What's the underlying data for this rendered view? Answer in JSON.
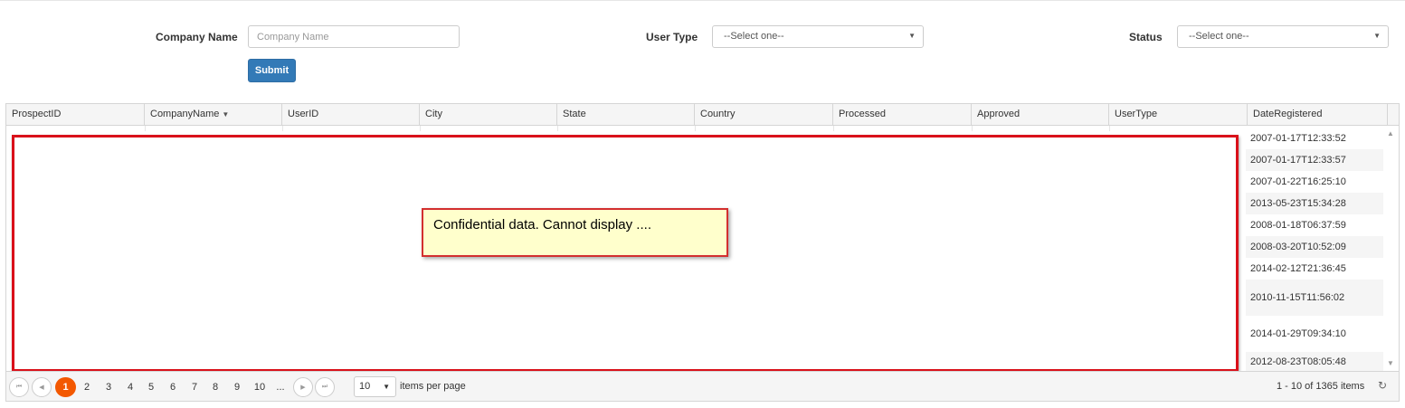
{
  "filters": {
    "company_name_label": "Company Name",
    "company_name_placeholder": "Company Name",
    "company_name_value": "",
    "user_type_label": "User Type",
    "user_type_value": "--Select one--",
    "status_label": "Status",
    "status_value": "--Select one--",
    "submit_label": "Submit"
  },
  "grid": {
    "columns": [
      "ProspectID",
      "CompanyName",
      "UserID",
      "City",
      "State",
      "Country",
      "Processed",
      "Approved",
      "UserType",
      "DateRegistered"
    ],
    "sorted_column": "CompanyName",
    "date_registered": [
      "2007-01-17T12:33:52",
      "2007-01-17T12:33:57",
      "2007-01-22T16:25:10",
      "2013-05-23T15:34:28",
      "2008-01-18T06:37:59",
      "2008-03-20T10:52:09",
      "2014-02-12T21:36:45",
      "2010-11-15T11:56:02",
      "2014-01-29T09:34:10",
      "2012-08-23T08:05:48"
    ],
    "redaction_note": "Confidential data. Cannot display ...."
  },
  "pager": {
    "pages": [
      "1",
      "2",
      "3",
      "4",
      "5",
      "6",
      "7",
      "8",
      "9",
      "10",
      "..."
    ],
    "current_page": "1",
    "page_size": "10",
    "items_per_page_label": "items per page",
    "info": "1 - 10 of 1365 items"
  },
  "icons": {
    "first": "first-page-icon",
    "prev": "prev-page-icon",
    "next": "next-page-icon",
    "last": "last-page-icon",
    "refresh": "refresh-icon",
    "dropdown": "chevron-down-icon",
    "sort": "sort-desc-icon"
  },
  "colors": {
    "submit": "#337ab7",
    "active_page": "#f35800",
    "redaction_border": "#d9111a",
    "note_background": "#ffffcc"
  }
}
